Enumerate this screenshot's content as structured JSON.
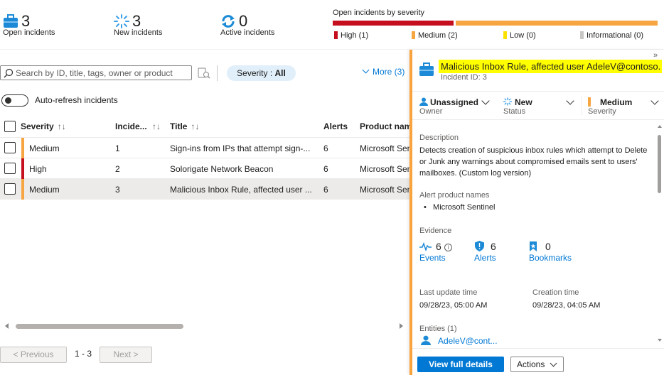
{
  "stats": {
    "open": {
      "value": "3",
      "label": "Open incidents"
    },
    "new": {
      "value": "3",
      "label": "New incidents"
    },
    "active": {
      "value": "0",
      "label": "Active incidents"
    }
  },
  "severity_summary": {
    "title": "Open incidents by severity",
    "legend": [
      {
        "label": "High (1)",
        "color": "#c50f1f"
      },
      {
        "label": "Medium (2)",
        "color": "#f7a541"
      },
      {
        "label": "Low (0)",
        "color": "#fce100"
      },
      {
        "label": "Informational (0)",
        "color": "#c8c6c4"
      }
    ]
  },
  "toolbar": {
    "search_placeholder": "Search by ID, title, tags, owner or product",
    "severity_filter_label": "Severity : ",
    "severity_filter_value": "All",
    "more_label": "More (3)"
  },
  "auto_refresh_label": "Auto-refresh incidents",
  "table": {
    "columns": [
      "Severity",
      "Incide...",
      "Title",
      "Alerts",
      "Product name"
    ],
    "rows": [
      {
        "severity": "Medium",
        "severity_color": "#f7a541",
        "id": "1",
        "title": "Sign-ins from IPs that attempt sign-...",
        "alerts": "6",
        "product": "Microsoft Sentinel"
      },
      {
        "severity": "High",
        "severity_color": "#c50f1f",
        "id": "2",
        "title": "Solorigate Network Beacon",
        "alerts": "6",
        "product": "Microsoft Sentinel"
      },
      {
        "severity": "Medium",
        "severity_color": "#f7a541",
        "id": "3",
        "title": "Malicious Inbox Rule, affected user ...",
        "alerts": "6",
        "product": "Microsoft Sentinel"
      }
    ]
  },
  "pagination": {
    "previous": "< Previous",
    "range": "1 - 3",
    "next": "Next >"
  },
  "panel": {
    "title": "Malicious Inbox Rule, affected user AdeleV@contoso.OnMicrosoft.com",
    "incident_id": "Incident ID: 3",
    "owner": {
      "value": "Unassigned",
      "label": "Owner"
    },
    "status": {
      "value": "New",
      "label": "Status"
    },
    "severity": {
      "value": "Medium",
      "label": "Severity"
    },
    "description_label": "Description",
    "description": "Detects creation of suspicious inbox rules which attempt to Delete or Junk any warnings about compromised emails sent to users' mailboxes. (Custom log version)",
    "alert_products_label": "Alert product names",
    "alert_products": [
      "Microsoft Sentinel"
    ],
    "evidence_label": "Evidence",
    "evidence": {
      "events": {
        "value": "6",
        "label": "Events"
      },
      "alerts": {
        "value": "6",
        "label": "Alerts"
      },
      "bookmarks": {
        "value": "0",
        "label": "Bookmarks"
      }
    },
    "last_update_label": "Last update time",
    "last_update": "09/28/23, 05:00 AM",
    "creation_label": "Creation time",
    "creation": "09/28/23, 04:05 AM",
    "entities_label": "Entities (1)",
    "entity": "AdeleV@cont...",
    "view_full_details": "View full details",
    "actions": "Actions"
  }
}
